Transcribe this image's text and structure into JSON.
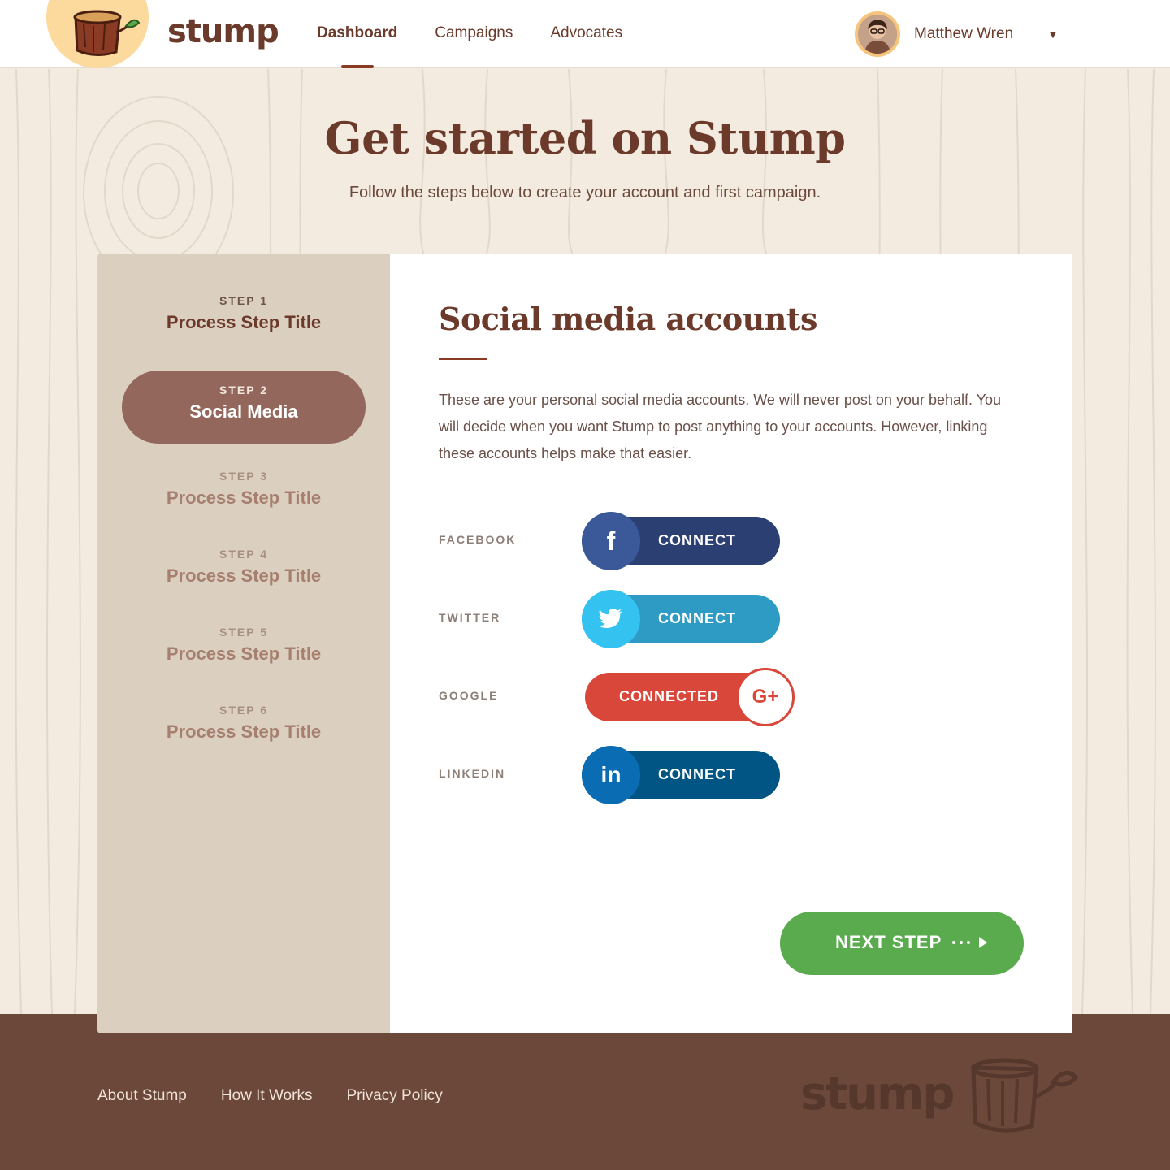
{
  "header": {
    "brand": "stump",
    "nav": [
      "Dashboard",
      "Campaigns",
      "Advocates"
    ],
    "active_nav": "Dashboard",
    "user_name": "Matthew Wren"
  },
  "hero": {
    "title": "Get started on Stump",
    "subtitle": "Follow the steps below to create your account and first campaign."
  },
  "steps": [
    {
      "label": "STEP 1",
      "title": "Process Step Title",
      "state": "done"
    },
    {
      "label": "STEP 2",
      "title": "Social Media",
      "state": "active"
    },
    {
      "label": "STEP 3",
      "title": "Process Step Title",
      "state": "upcoming"
    },
    {
      "label": "STEP 4",
      "title": "Process Step Title",
      "state": "upcoming"
    },
    {
      "label": "STEP 5",
      "title": "Process Step Title",
      "state": "upcoming"
    },
    {
      "label": "STEP 6",
      "title": "Process Step Title",
      "state": "upcoming"
    }
  ],
  "content": {
    "title": "Social media accounts",
    "description": "These are your personal social media accounts. We will never post on your behalf. You will decide when you want Stump to post anything to your accounts. However, linking these accounts helps make that easier.",
    "accounts": [
      {
        "label": "FACEBOOK",
        "button": "CONNECT",
        "icon": "facebook-icon",
        "color": "#2b3f73",
        "icon_color": "#3b5998"
      },
      {
        "label": "TWITTER",
        "button": "CONNECT",
        "icon": "twitter-icon",
        "color": "#2d9bc3",
        "icon_color": "#34c2f0"
      },
      {
        "label": "GOOGLE",
        "button": "CONNECTED",
        "icon": "google-plus-icon",
        "color": "#d9473a",
        "icon_color": "#d9473a"
      },
      {
        "label": "LINKEDIN",
        "button": "CONNECT",
        "icon": "linkedin-icon",
        "color": "#005585",
        "icon_color": "#0a6db4"
      }
    ],
    "next_label": "NEXT STEP"
  },
  "footer": {
    "links": [
      "About Stump",
      "How It Works",
      "Privacy Policy"
    ],
    "brand": "stump"
  },
  "colors": {
    "brand_brown": "#6b3a2a",
    "accent_green": "#5aab4d",
    "footer_bg": "#6c483b",
    "background": "#f3ebe0"
  }
}
